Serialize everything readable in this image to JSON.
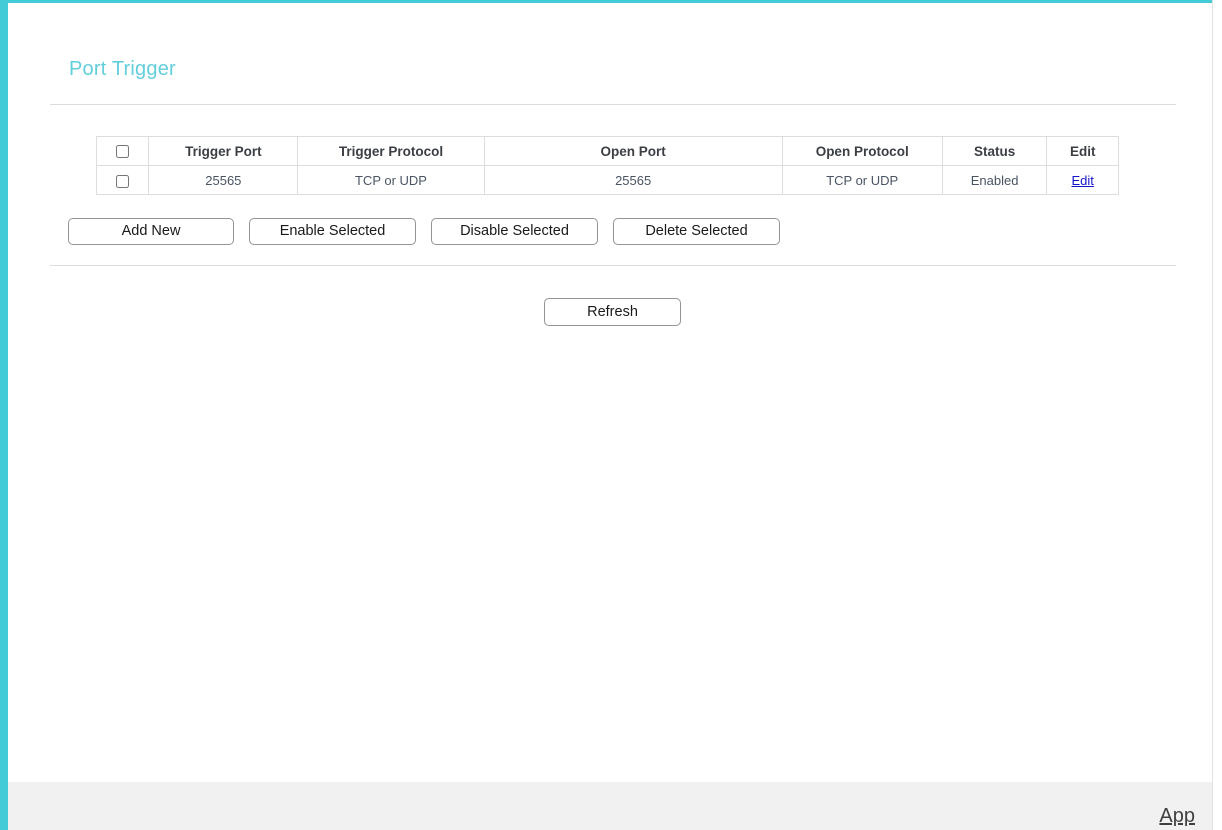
{
  "theme": {
    "accent_color": "#44cbd8",
    "title_color": "#62cfdb",
    "link_color": "#1414cc",
    "footer_bg": "#f1f1f1",
    "table_border": "#dddddd"
  },
  "page": {
    "title": "Port Trigger"
  },
  "table": {
    "columns": [
      {
        "key": "select",
        "label": ""
      },
      {
        "key": "trigger_port",
        "label": "Trigger Port"
      },
      {
        "key": "trigger_proto",
        "label": "Trigger Protocol"
      },
      {
        "key": "open_port",
        "label": "Open Port"
      },
      {
        "key": "open_proto",
        "label": "Open Protocol"
      },
      {
        "key": "status",
        "label": "Status"
      },
      {
        "key": "edit",
        "label": "Edit"
      }
    ],
    "header_select_all_checked": false,
    "rows": [
      {
        "selected": false,
        "trigger_port": "25565",
        "trigger_proto": "TCP or UDP",
        "open_port": "25565",
        "open_proto": "TCP or UDP",
        "status": "Enabled",
        "edit_label": "Edit"
      }
    ]
  },
  "actions": {
    "add_new": "Add New",
    "enable_selected": "Enable Selected",
    "disable_selected": "Disable Selected",
    "delete_selected": "Delete Selected",
    "refresh": "Refresh"
  },
  "footer": {
    "app_link": "App"
  }
}
